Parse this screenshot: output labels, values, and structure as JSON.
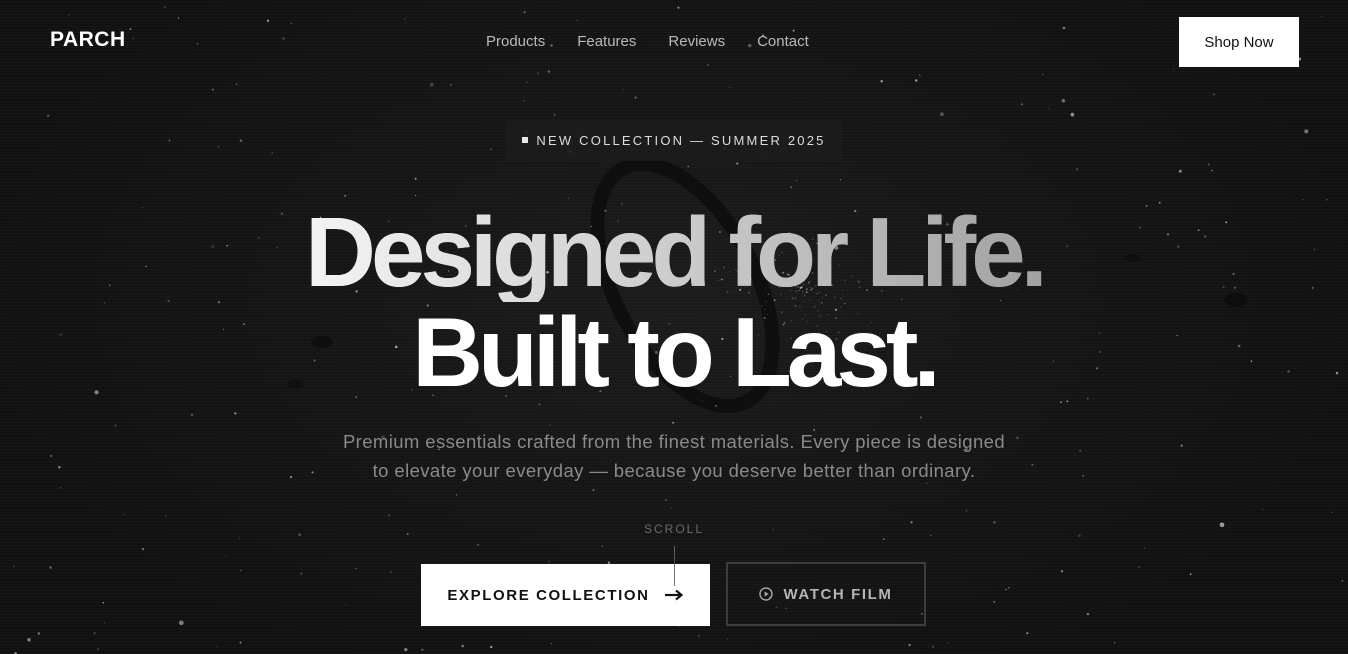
{
  "brand": {
    "logo": "PARCH"
  },
  "nav": {
    "items": [
      "Products",
      "Features",
      "Reviews",
      "Contact"
    ],
    "cta_label": "Shop Now"
  },
  "hero": {
    "badge": "NEW COLLECTION — SUMMER 2025",
    "headline_line1": "Designed for Life.",
    "headline_line2": "Built to Last.",
    "description": "Premium essentials crafted from the finest materials. Every piece is designed to elevate your everyday — because you deserve better than ordinary.",
    "scroll_label": "SCROLL",
    "primary_cta": "EXPLORE COLLECTION",
    "secondary_cta": "WATCH FILM"
  },
  "icons": {
    "primary_cta_icon": "arrow-right-icon",
    "secondary_cta_icon": "play-circle-icon",
    "badge_icon": "square-bullet-icon"
  },
  "colors": {
    "background": "#131313",
    "text_primary": "#ffffff",
    "text_muted": "#8a8a8a",
    "button_bg": "#ffffff",
    "button_text": "#111111",
    "outline": "#3d3d3d"
  }
}
